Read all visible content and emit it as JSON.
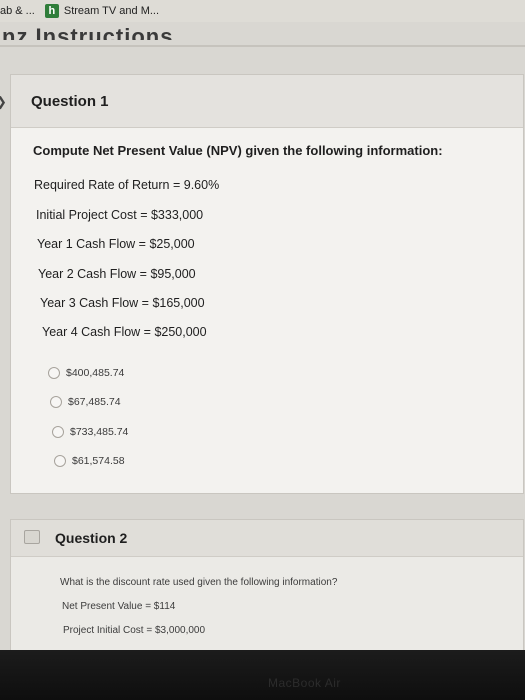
{
  "bookmarks": [
    {
      "label": "ab & ...",
      "icon": "none"
    },
    {
      "label": "Stream TV and M...",
      "icon": "h-logo",
      "icon_letter": "h"
    }
  ],
  "page_heading": "nz Instructions",
  "question1": {
    "title": "Question 1",
    "prompt": "Compute Net Present Value (NPV) given the following information:",
    "lines": [
      "Required Rate of Return = 9.60%",
      "Initial Project Cost = $333,000",
      "Year 1 Cash Flow = $25,000",
      "Year 2 Cash Flow = $95,000",
      "Year 3 Cash Flow = $165,000",
      "Year 4 Cash Flow = $250,000"
    ],
    "options": [
      "$400,485.74",
      "$67,485.74",
      "$733,485.74",
      "$61,574.58"
    ]
  },
  "question2": {
    "title": "Question 2",
    "prompt": "What is the discount rate used given the following information?",
    "lines": [
      "Net Present Value = $114",
      "Project Initial Cost = $3,000,000"
    ]
  },
  "bezel": {
    "brand": "MacBook Air"
  }
}
